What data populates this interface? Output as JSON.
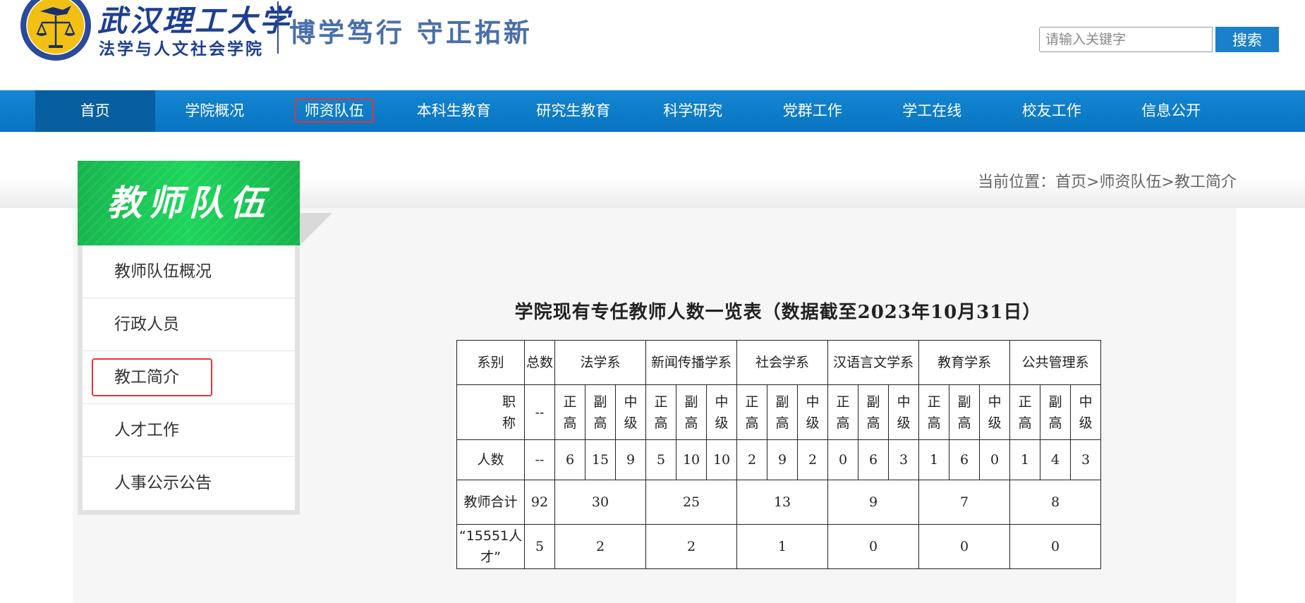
{
  "header": {
    "school_name": "武汉理工大学",
    "college_name": "法学与人文社会学院",
    "motto": "博学笃行 守正拓新",
    "search_placeholder": "请输入关键字",
    "search_button": "搜索"
  },
  "nav": {
    "items": [
      {
        "label": "首页"
      },
      {
        "label": "学院概况"
      },
      {
        "label": "师资队伍"
      },
      {
        "label": "本科生教育"
      },
      {
        "label": "研究生教育"
      },
      {
        "label": "科学研究"
      },
      {
        "label": "党群工作"
      },
      {
        "label": "学工在线"
      },
      {
        "label": "校友工作"
      },
      {
        "label": "信息公开"
      }
    ],
    "active_index": 0,
    "highlight_index": 2
  },
  "breadcrumb": "当前位置：首页>师资队伍>教工简介",
  "sidebar": {
    "title": "教师队伍",
    "items": [
      {
        "label": "教师队伍概况"
      },
      {
        "label": "行政人员"
      },
      {
        "label": "教工简介"
      },
      {
        "label": "人才工作"
      },
      {
        "label": "人事公示公告"
      }
    ],
    "highlight_index": 2
  },
  "table": {
    "title": "学院现有专任教师人数一览表（数据截至2023年10月31日）",
    "header": {
      "dept_label": "系别",
      "total_label": "总数",
      "departments": [
        "法学系",
        "新闻传播学系",
        "社会学系",
        "汉语言文学系",
        "教育学系",
        "公共管理系"
      ]
    },
    "title_row": {
      "label": "职称",
      "total": "--",
      "ranks": [
        "正高",
        "副高",
        "中级"
      ]
    },
    "count_row": {
      "label": "人数",
      "total": "--",
      "values": [
        "6",
        "15",
        "9",
        "5",
        "10",
        "10",
        "2",
        "9",
        "2",
        "0",
        "6",
        "3",
        "1",
        "6",
        "0",
        "1",
        "4",
        "3"
      ]
    },
    "sum_row": {
      "label": "教师合计",
      "total": "92",
      "values": [
        "30",
        "25",
        "13",
        "9",
        "7",
        "8"
      ]
    },
    "talent_row": {
      "label": "“15551人才”",
      "total": "5",
      "values": [
        "2",
        "2",
        "1",
        "0",
        "0",
        "0"
      ]
    }
  }
}
